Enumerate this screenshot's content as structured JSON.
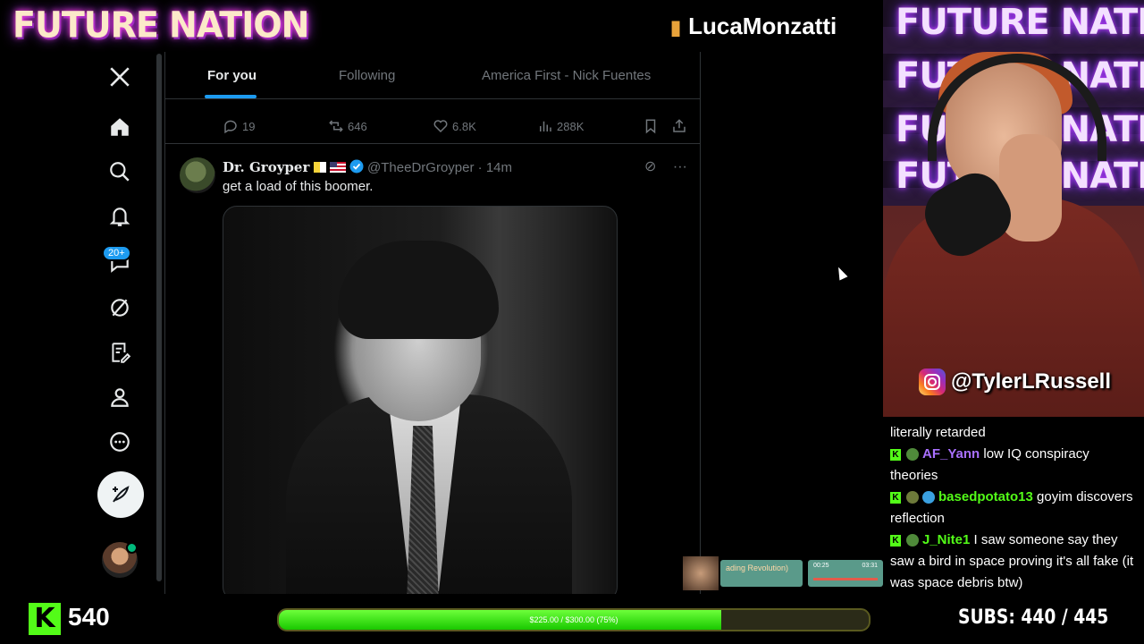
{
  "overlay": {
    "brand": "FUTURE NATION",
    "streamer": "LucaMonzatti",
    "instagram_handle": "@TylerLRussell",
    "webcam_neon_text": "FUTURE NATION",
    "kick_count": "540",
    "goal_text": "$225.00 / $300.00 (75%)",
    "goal_progress": 0.75,
    "subs_label": "SUBS:",
    "subs_value": "440 / 445",
    "mini_player_title": "ading Revolution)",
    "mini_player_time_start": "00:25",
    "mini_player_time_end": "03:31"
  },
  "twitter": {
    "nav": {
      "icons": [
        "x-logo-icon",
        "home-icon",
        "search-icon",
        "notifications-icon",
        "messages-icon",
        "grok-icon",
        "lists-icon",
        "profile-icon",
        "more-icon"
      ],
      "messages_badge": "20+"
    },
    "tabs": [
      {
        "label": "For you",
        "active": true
      },
      {
        "label": "Following",
        "active": false
      },
      {
        "label": "America First - Nick Fuentes",
        "active": false
      }
    ],
    "prev_post_actions": {
      "replies": "19",
      "reposts": "646",
      "likes": "6.8K",
      "views": "288K"
    },
    "tweet": {
      "display_name": "Dr. Groyper",
      "handle": "@TheeDrGroyper",
      "time": "· 14m",
      "text": "get a load of this boomer."
    }
  },
  "chat": [
    {
      "user": "",
      "message": "literally retarded",
      "color": "#ffffff"
    },
    {
      "user": "AF_Yann",
      "message": " low IQ conspiracy theories",
      "color": "#a970ff"
    },
    {
      "user": "basedpotato13",
      "message": " goyim discovers reflection",
      "color": "#53fc18"
    },
    {
      "user": "J_Nite1",
      "message": " I saw someone say they saw a bird in space proving it's all fake (it was space debris btw)",
      "color": "#53fc18"
    }
  ]
}
